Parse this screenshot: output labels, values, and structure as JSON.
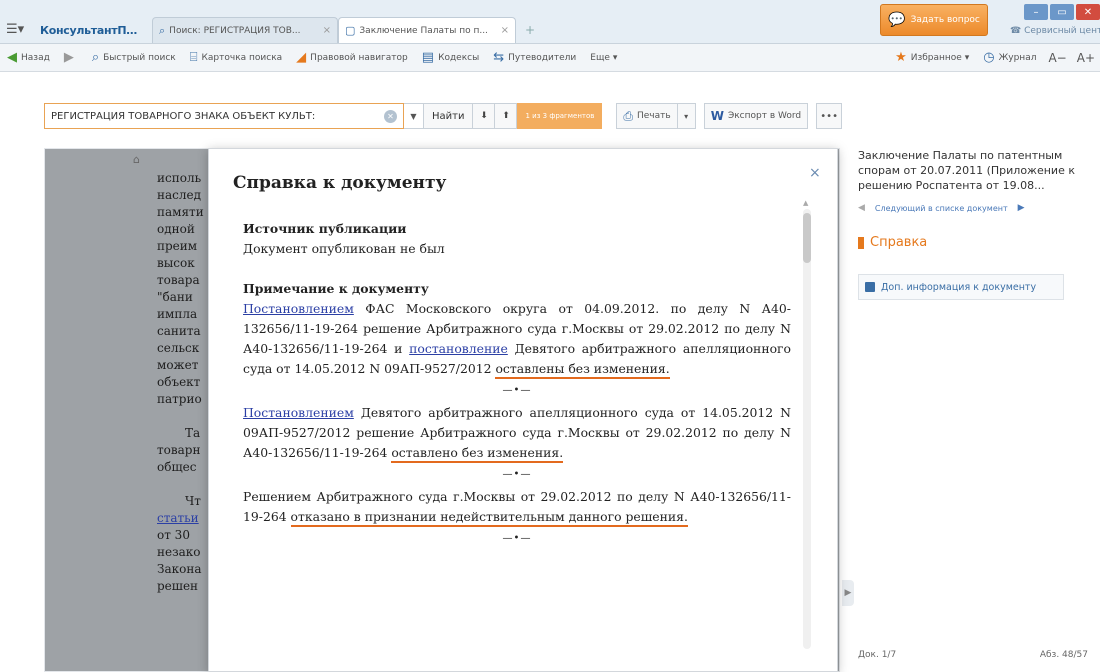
{
  "tabbar": {
    "brand": "КонсультантПлюс",
    "tabs": [
      {
        "label": "Поиск: РЕГИСТРАЦИЯ ТОВ...",
        "close": "×"
      },
      {
        "label": "Заключение Палаты по п...",
        "close": "×"
      }
    ],
    "new_tab": "+",
    "ask_button": "Задать вопрос",
    "service_link": "Сервисный центр"
  },
  "toolbar": {
    "back": "Назад",
    "quick_search": "Быстрый поиск",
    "search_card": "Карточка поиска",
    "legal_navigator": "Правовой навигатор",
    "codes": "Кодексы",
    "guides": "Путеводители",
    "more": "Еще ▾",
    "favorites": "Избранное ▾",
    "journal": "Журнал",
    "font_smaller": "A−",
    "font_larger": "A+"
  },
  "search": {
    "query": "РЕГИСТРАЦИЯ ТОВАРНОГО ЗНАКА ОБЪЕКТ КУЛЬТ:",
    "find_label": "Найти",
    "fragments": "1 из 3 фрагментов",
    "print_label": "Печать",
    "export_label": "Экспорт в Word",
    "more_label": "•••"
  },
  "document_lines": [
    {
      "text": "",
      "type": ""
    },
    {
      "text": "исполь",
      "type": ""
    },
    {
      "text": "наслед",
      "type": ""
    },
    {
      "text": "памяти",
      "type": ""
    },
    {
      "text": "одной",
      "type": ""
    },
    {
      "text": "преим",
      "type": ""
    },
    {
      "text": "высок",
      "type": ""
    },
    {
      "text": "товара",
      "type": ""
    },
    {
      "text": "\"бани",
      "type": ""
    },
    {
      "text": "импла",
      "type": ""
    },
    {
      "text": "санита",
      "type": ""
    },
    {
      "text": "сельск",
      "type": ""
    },
    {
      "text": "может",
      "type": ""
    },
    {
      "text": "объект",
      "type": ""
    },
    {
      "text": "патрио",
      "type": ""
    },
    {
      "text": "",
      "type": ""
    },
    {
      "text": "Та",
      "type": "ind"
    },
    {
      "text": "товарн",
      "type": ""
    },
    {
      "text": "общес",
      "type": ""
    },
    {
      "text": "",
      "type": ""
    },
    {
      "text": "Чт",
      "type": "ind"
    },
    {
      "text": "статьи",
      "type": "lnk"
    },
    {
      "text": "от 30",
      "type": ""
    },
    {
      "text": "незако",
      "type": ""
    },
    {
      "text": "Закона",
      "type": ""
    },
    {
      "text": "решен",
      "type": ""
    }
  ],
  "modal": {
    "title": "Справка к документу",
    "close": "×",
    "source_heading": "Источник публикации",
    "source_text": "Документ опубликован не был",
    "note_heading": "Примечание к документу",
    "note1": {
      "link1": "Постановлением",
      "text1": " ФАС Московского округа от 04.09.2012. по делу N А40-132656/11-19-264 решение Арбитражного суда г.Москвы от 29.02.2012 по делу N А40-132656/11-19-264 и ",
      "link2": "постановление",
      "text2": " Девятого арбитражного апелляционного суда от 14.05.2012 N 09АП-9527/2012 ",
      "highlight": "оставлены без изменения."
    },
    "note2": {
      "link1": "Постановлением",
      "text1": " Девятого арбитражного апелляционного суда от 14.05.2012 N 09АП-9527/2012 решение Арбитражного суда г.Москвы от 29.02.2012 по делу N А40-132656/11-19-264 ",
      "highlight": "оставлено без изменения."
    },
    "note3": {
      "text1": "Решением Арбитражного суда г.Москвы от 29.02.2012 по делу N А40-132656/11-19-264 ",
      "highlight": "отказано в признании недействительным данного решения."
    }
  },
  "right_panel": {
    "doc_title": "Заключение Палаты по патентным спорам от 20.07.2011 (Приложение к решению Роспатента от 19.08...",
    "next_doc": "Следующий в списке документ",
    "spravka": "Справка",
    "dop_info": "Доп. информация к документу",
    "doc_counter": "Док. 1/7",
    "paragraph_counter": "Абз. 48/57"
  }
}
